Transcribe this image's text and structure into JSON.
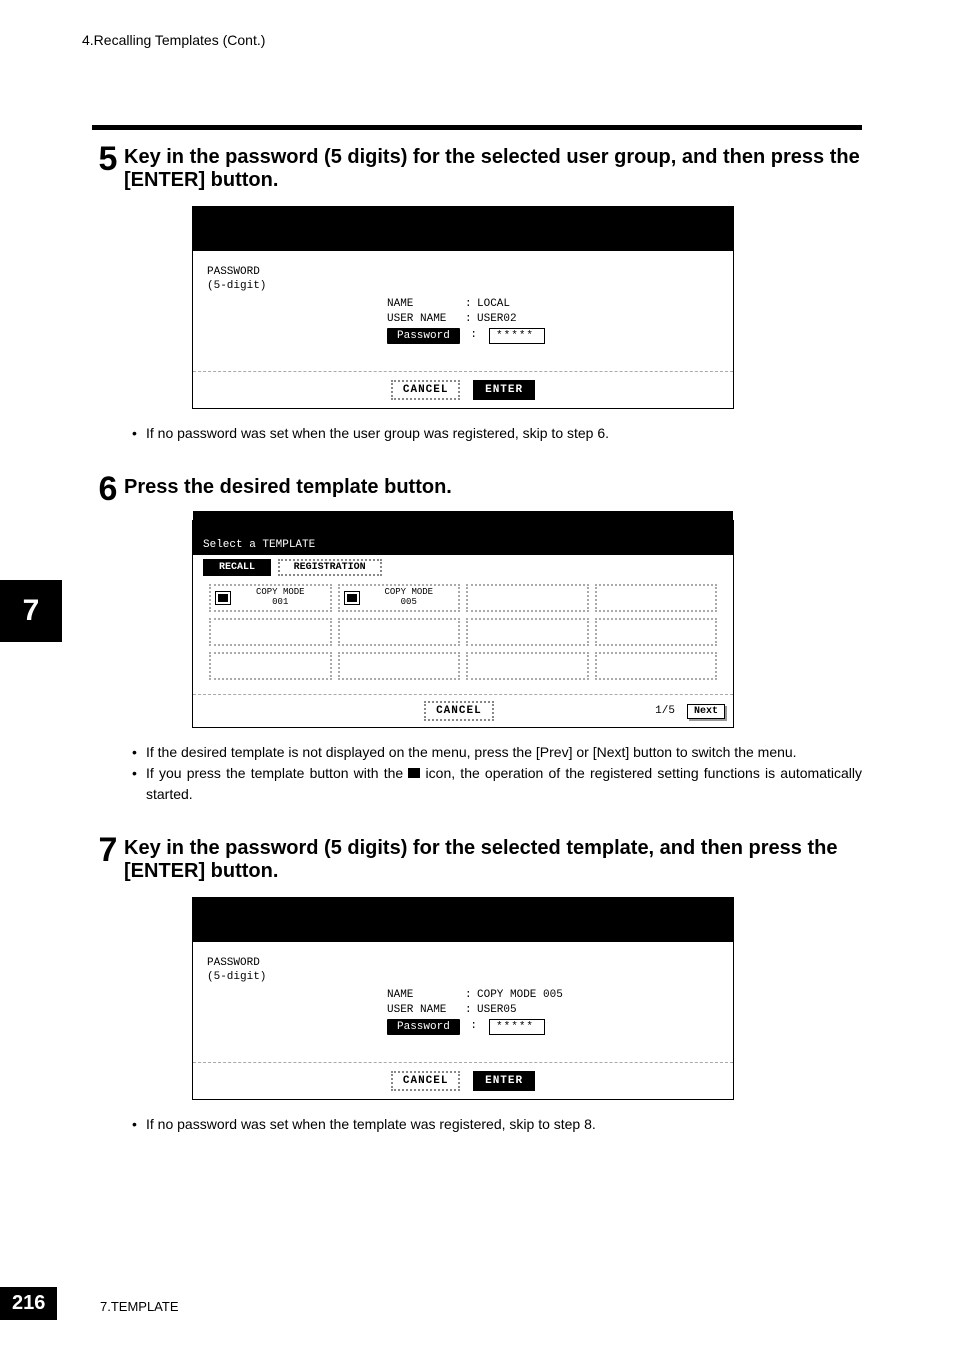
{
  "header": {
    "section": "4.Recalling Templates (Cont.)"
  },
  "sideTab": "7",
  "step5": {
    "num": "5",
    "text": "Key in the password (5 digits) for the selected user group, and then press the [ENTER] button.",
    "screen": {
      "pwTitle1": "PASSWORD",
      "pwTitle2": "(5-digit)",
      "nameLabel": "NAME",
      "nameVal": "LOCAL",
      "userLabel": "USER NAME",
      "userVal": "USER02",
      "pwLabel": "Password",
      "pwVal": "*****",
      "cancel": "CANCEL",
      "enter": "ENTER"
    },
    "note": "If no password was set when the user group was registered, skip to step 6."
  },
  "step6": {
    "num": "6",
    "text": "Press the desired template button.",
    "screen": {
      "title": "Select a TEMPLATE",
      "tabRecall": "RECALL",
      "tabReg": "REGISTRATION",
      "tpl1": "COPY MODE\n001",
      "tpl2": "COPY MODE\n005",
      "cancel": "CANCEL",
      "pager": "1/5",
      "next": "Next"
    },
    "note1": "If the desired template is not displayed on the menu, press the [Prev] or [Next] button to switch the menu.",
    "note2a": "If you press the template button with the ",
    "note2b": " icon, the operation of the registered setting functions is automatically started."
  },
  "step7": {
    "num": "7",
    "text": "Key in the password (5 digits) for the selected template, and then press the [ENTER] button.",
    "screen": {
      "pwTitle1": "PASSWORD",
      "pwTitle2": "(5-digit)",
      "nameLabel": "NAME",
      "nameVal": "COPY MODE 005",
      "userLabel": "USER NAME",
      "userVal": "USER05",
      "pwLabel": "Password",
      "pwVal": "*****",
      "cancel": "CANCEL",
      "enter": "ENTER"
    },
    "note": "If no password was set when the template was registered, skip to step 8."
  },
  "footer": {
    "page": "216",
    "chapter": "7.TEMPLATE"
  }
}
